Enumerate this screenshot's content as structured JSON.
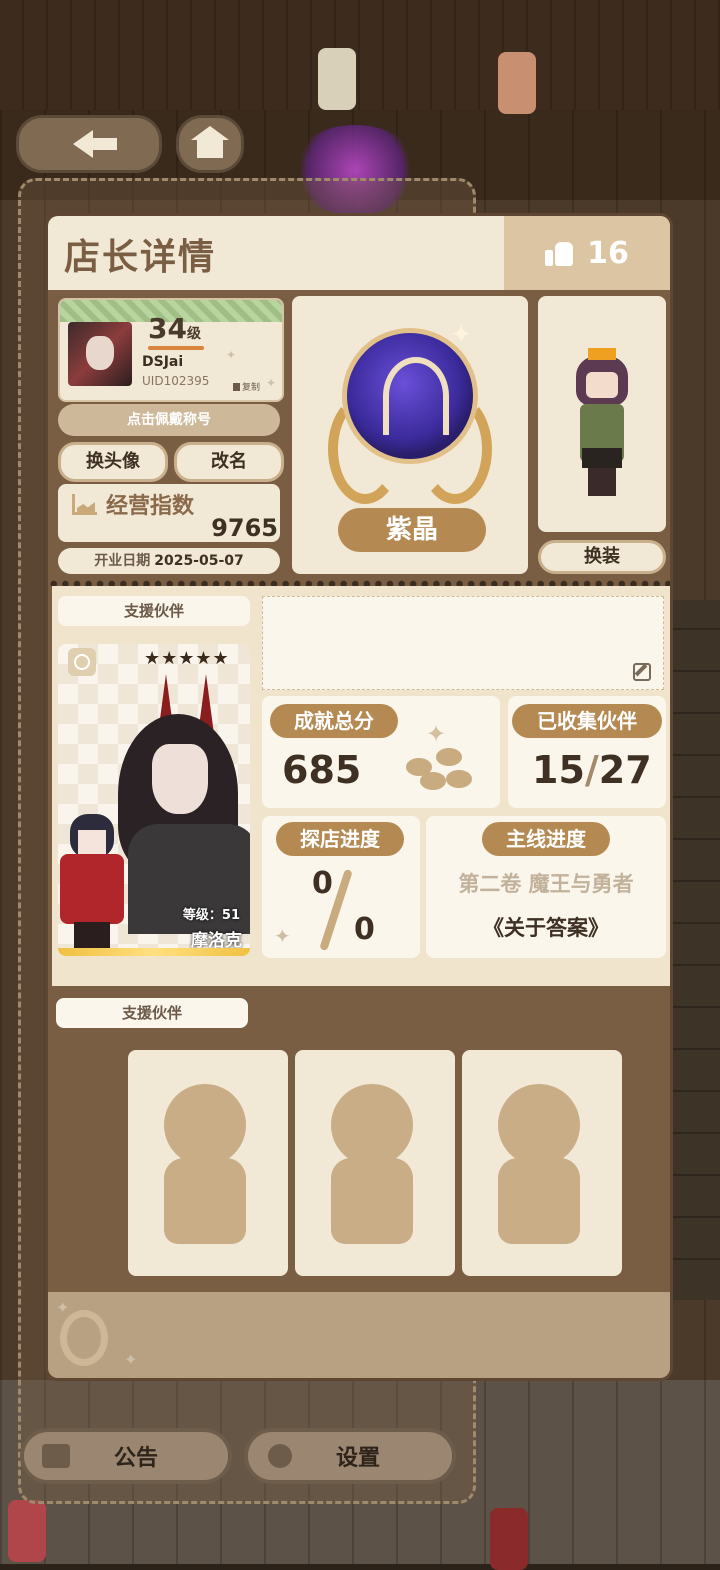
{
  "header": {
    "title": "店长详情",
    "likes": "16"
  },
  "profile": {
    "level": "34",
    "level_unit": "级",
    "name": "DSJai",
    "uid": "UID102395",
    "copy_label": "复制",
    "title_hint": "点击佩戴称号",
    "change_avatar": "换头像",
    "rename": "改名",
    "business_label": "经营指数",
    "business_value": "9765",
    "open_date_label": "开业日期",
    "open_date": "2025-05-07"
  },
  "badge": {
    "rank": "紫晶"
  },
  "outfit": {
    "button": "换装"
  },
  "partner": {
    "section_label": "支援伙伴",
    "stars": "★★★★★",
    "level_text": "等级：51",
    "name": "摩洛克"
  },
  "stats": {
    "achievement_label": "成就总分",
    "achievement_value": "685",
    "collected_label": "已收集伙伴",
    "collected_value": "15",
    "collected_total": "27",
    "explore_label": "探店进度",
    "explore_current": "0",
    "explore_total": "0",
    "story_label": "主线进度",
    "story_volume": "第二卷 魔王与勇者",
    "story_chapter": "《关于答案》"
  },
  "support": {
    "section_label": "支援伙伴"
  },
  "bottom": {
    "notice": "公告",
    "settings": "设置"
  },
  "colors": {
    "accent": "#b48a52",
    "panel": "#f2e8d6",
    "card": "#7a5e44"
  }
}
